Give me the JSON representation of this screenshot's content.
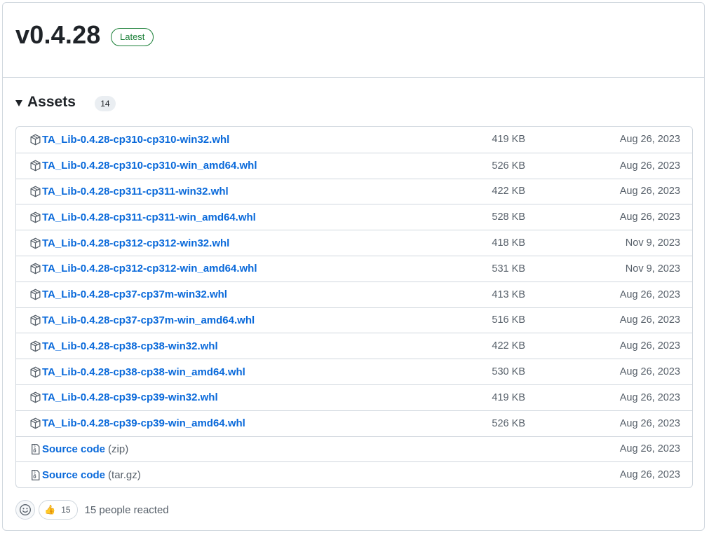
{
  "release": {
    "title": "v0.4.28",
    "badge": "Latest"
  },
  "assets": {
    "title": "Assets",
    "count": "14",
    "items": [
      {
        "name": "TA_Lib-0.4.28-cp310-cp310-win32.whl",
        "suffix": "",
        "size": "419 KB",
        "date": "Aug 26, 2023",
        "icon": "package-icon"
      },
      {
        "name": "TA_Lib-0.4.28-cp310-cp310-win_amd64.whl",
        "suffix": "",
        "size": "526 KB",
        "date": "Aug 26, 2023",
        "icon": "package-icon"
      },
      {
        "name": "TA_Lib-0.4.28-cp311-cp311-win32.whl",
        "suffix": "",
        "size": "422 KB",
        "date": "Aug 26, 2023",
        "icon": "package-icon"
      },
      {
        "name": "TA_Lib-0.4.28-cp311-cp311-win_amd64.whl",
        "suffix": "",
        "size": "528 KB",
        "date": "Aug 26, 2023",
        "icon": "package-icon"
      },
      {
        "name": "TA_Lib-0.4.28-cp312-cp312-win32.whl",
        "suffix": "",
        "size": "418 KB",
        "date": "Nov 9, 2023",
        "icon": "package-icon"
      },
      {
        "name": "TA_Lib-0.4.28-cp312-cp312-win_amd64.whl",
        "suffix": "",
        "size": "531 KB",
        "date": "Nov 9, 2023",
        "icon": "package-icon"
      },
      {
        "name": "TA_Lib-0.4.28-cp37-cp37m-win32.whl",
        "suffix": "",
        "size": "413 KB",
        "date": "Aug 26, 2023",
        "icon": "package-icon"
      },
      {
        "name": "TA_Lib-0.4.28-cp37-cp37m-win_amd64.whl",
        "suffix": "",
        "size": "516 KB",
        "date": "Aug 26, 2023",
        "icon": "package-icon"
      },
      {
        "name": "TA_Lib-0.4.28-cp38-cp38-win32.whl",
        "suffix": "",
        "size": "422 KB",
        "date": "Aug 26, 2023",
        "icon": "package-icon"
      },
      {
        "name": "TA_Lib-0.4.28-cp38-cp38-win_amd64.whl",
        "suffix": "",
        "size": "530 KB",
        "date": "Aug 26, 2023",
        "icon": "package-icon"
      },
      {
        "name": "TA_Lib-0.4.28-cp39-cp39-win32.whl",
        "suffix": "",
        "size": "419 KB",
        "date": "Aug 26, 2023",
        "icon": "package-icon"
      },
      {
        "name": "TA_Lib-0.4.28-cp39-cp39-win_amd64.whl",
        "suffix": "",
        "size": "526 KB",
        "date": "Aug 26, 2023",
        "icon": "package-icon"
      },
      {
        "name": "Source code",
        "suffix": "(zip)",
        "size": "",
        "date": "Aug 26, 2023",
        "icon": "file-zip-icon"
      },
      {
        "name": "Source code",
        "suffix": "(tar.gz)",
        "size": "",
        "date": "Aug 26, 2023",
        "icon": "file-zip-icon"
      }
    ]
  },
  "reactions": {
    "add_icon": "smiley-icon",
    "emoji": "👍",
    "count": "15",
    "summary": "15 people reacted"
  },
  "colors": {
    "link": "#0969da",
    "badge_green": "#1a7f37",
    "muted": "#57606a",
    "border": "#d0d7de"
  }
}
